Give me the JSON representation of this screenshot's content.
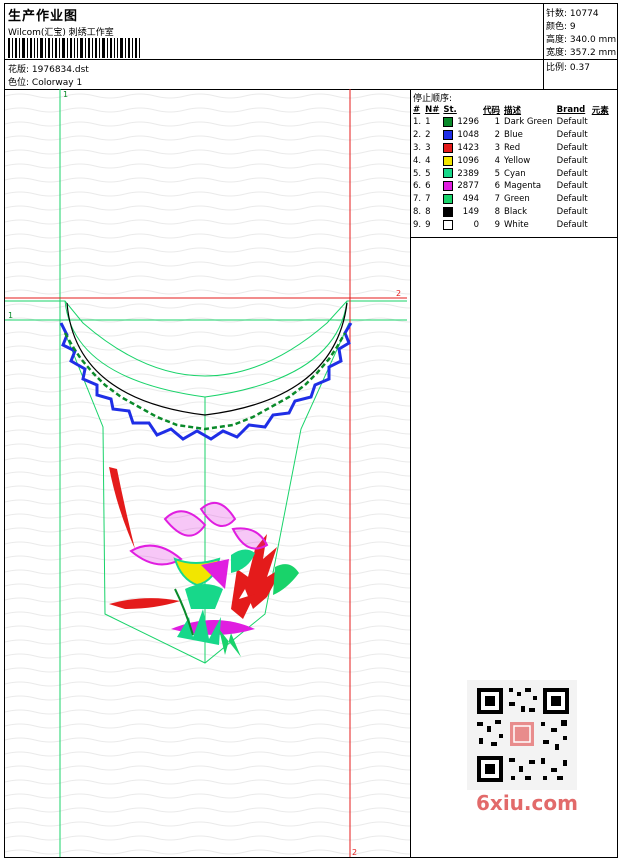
{
  "header": {
    "title": "生产作业图",
    "vendor": "Wilcom(汇宝) 刺绣工作室",
    "design_label": "花版:",
    "design_value": "1976834.dst",
    "colorway_label": "色位:",
    "colorway_value": "Colorway 1"
  },
  "stats": {
    "stitches_label": "针数:",
    "stitches_value": "10774",
    "colors_label": "颜色:",
    "colors_value": "9",
    "height_label": "高度:",
    "height_value": "340.0 mm",
    "width_label": "宽度:",
    "width_value": "357.2 mm",
    "scale_label": "比例:",
    "scale_value": "0.37"
  },
  "stop_sequence": {
    "title": "停止顺序:",
    "columns": [
      "#",
      "N#",
      "St.",
      "代码",
      "描述",
      "Brand",
      "元素"
    ],
    "rows": [
      {
        "idx": "1.",
        "n": "1",
        "color": "#0a8a2a",
        "st": "1296",
        "code": "1",
        "desc": "Dark Green",
        "brand": "Default"
      },
      {
        "idx": "2.",
        "n": "2",
        "color": "#1f2ee6",
        "st": "1048",
        "code": "2",
        "desc": "Blue",
        "brand": "Default"
      },
      {
        "idx": "3.",
        "n": "3",
        "color": "#e41b1b",
        "st": "1423",
        "code": "3",
        "desc": "Red",
        "brand": "Default"
      },
      {
        "idx": "4.",
        "n": "4",
        "color": "#f2e600",
        "st": "1096",
        "code": "4",
        "desc": "Yellow",
        "brand": "Default"
      },
      {
        "idx": "5.",
        "n": "5",
        "color": "#17d88a",
        "st": "2389",
        "code": "5",
        "desc": "Cyan",
        "brand": "Default"
      },
      {
        "idx": "6.",
        "n": "6",
        "color": "#e01ee0",
        "st": "2877",
        "code": "6",
        "desc": "Magenta",
        "brand": "Default"
      },
      {
        "idx": "7.",
        "n": "7",
        "color": "#19d36a",
        "st": "494",
        "code": "7",
        "desc": "Green",
        "brand": "Default"
      },
      {
        "idx": "8.",
        "n": "8",
        "color": "#000000",
        "st": "149",
        "code": "8",
        "desc": "Black",
        "brand": "Default"
      },
      {
        "idx": "9.",
        "n": "9",
        "color": "#ffffff",
        "st": "0",
        "code": "9",
        "desc": "White",
        "brand": "Default"
      }
    ]
  },
  "guides": {
    "v1": "1",
    "h1": "1",
    "h2": "2",
    "v2": "2"
  },
  "watermark": "6xiu.com"
}
